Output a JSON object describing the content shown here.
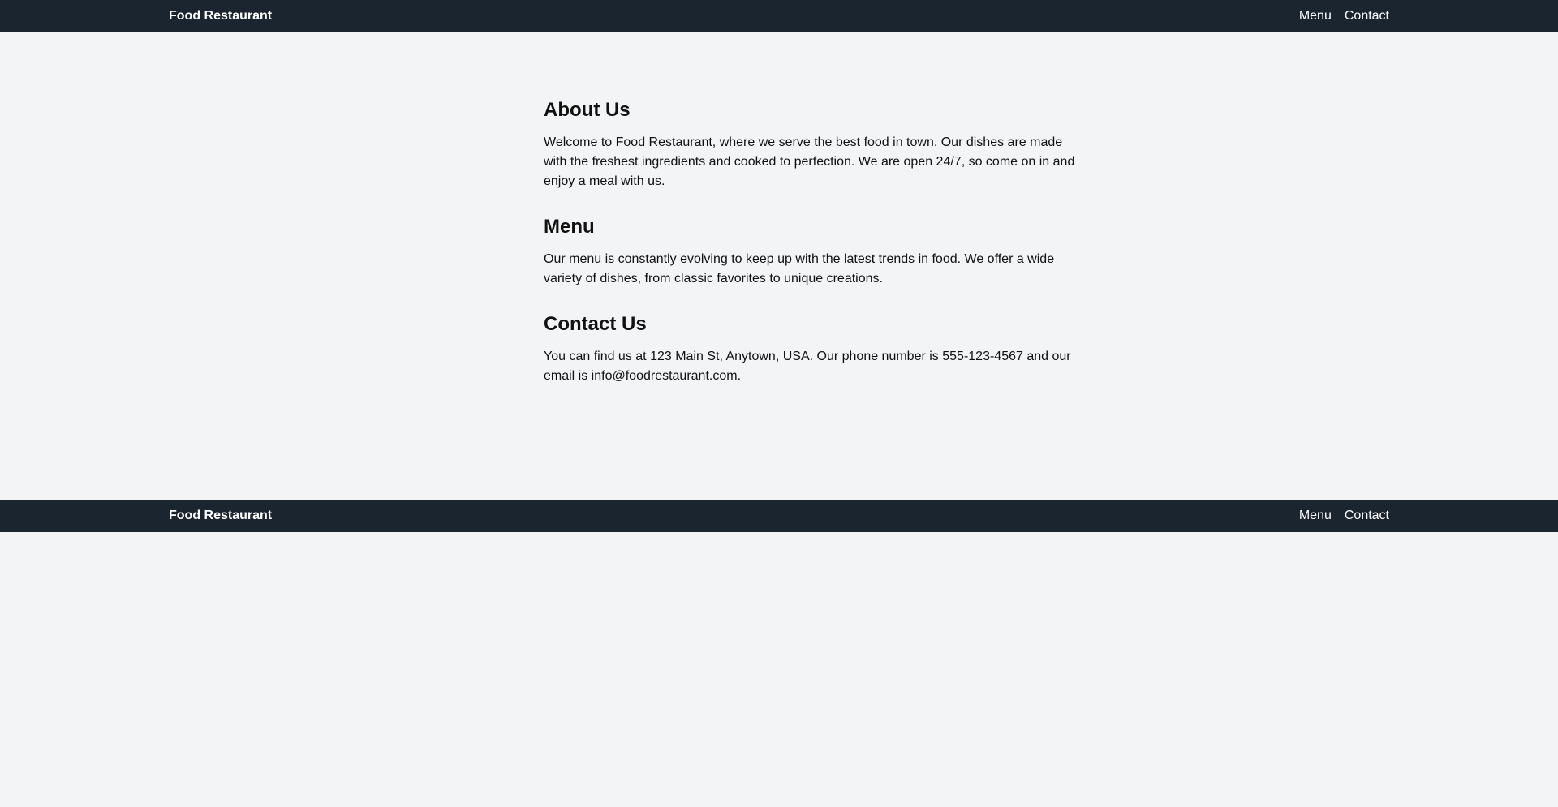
{
  "header": {
    "brand": "Food Restaurant",
    "nav": [
      {
        "label": "Menu"
      },
      {
        "label": "Contact"
      }
    ]
  },
  "sections": [
    {
      "title": "About Us",
      "text": "Welcome to Food Restaurant, where we serve the best food in town. Our dishes are made with the freshest ingredients and cooked to perfection. We are open 24/7, so come on in and enjoy a meal with us."
    },
    {
      "title": "Menu",
      "text": "Our menu is constantly evolving to keep up with the latest trends in food. We offer a wide variety of dishes, from classic favorites to unique creations."
    },
    {
      "title": "Contact Us",
      "text": "You can find us at 123 Main St, Anytown, USA. Our phone number is 555-123-4567 and our email is info@foodrestaurant.com."
    }
  ],
  "footer": {
    "brand": "Food Restaurant",
    "nav": [
      {
        "label": "Menu"
      },
      {
        "label": "Contact"
      }
    ]
  },
  "colors": {
    "bar_background": "#1b2530",
    "page_background": "#f3f4f6",
    "text": "#111111",
    "bar_text": "#ffffff"
  }
}
